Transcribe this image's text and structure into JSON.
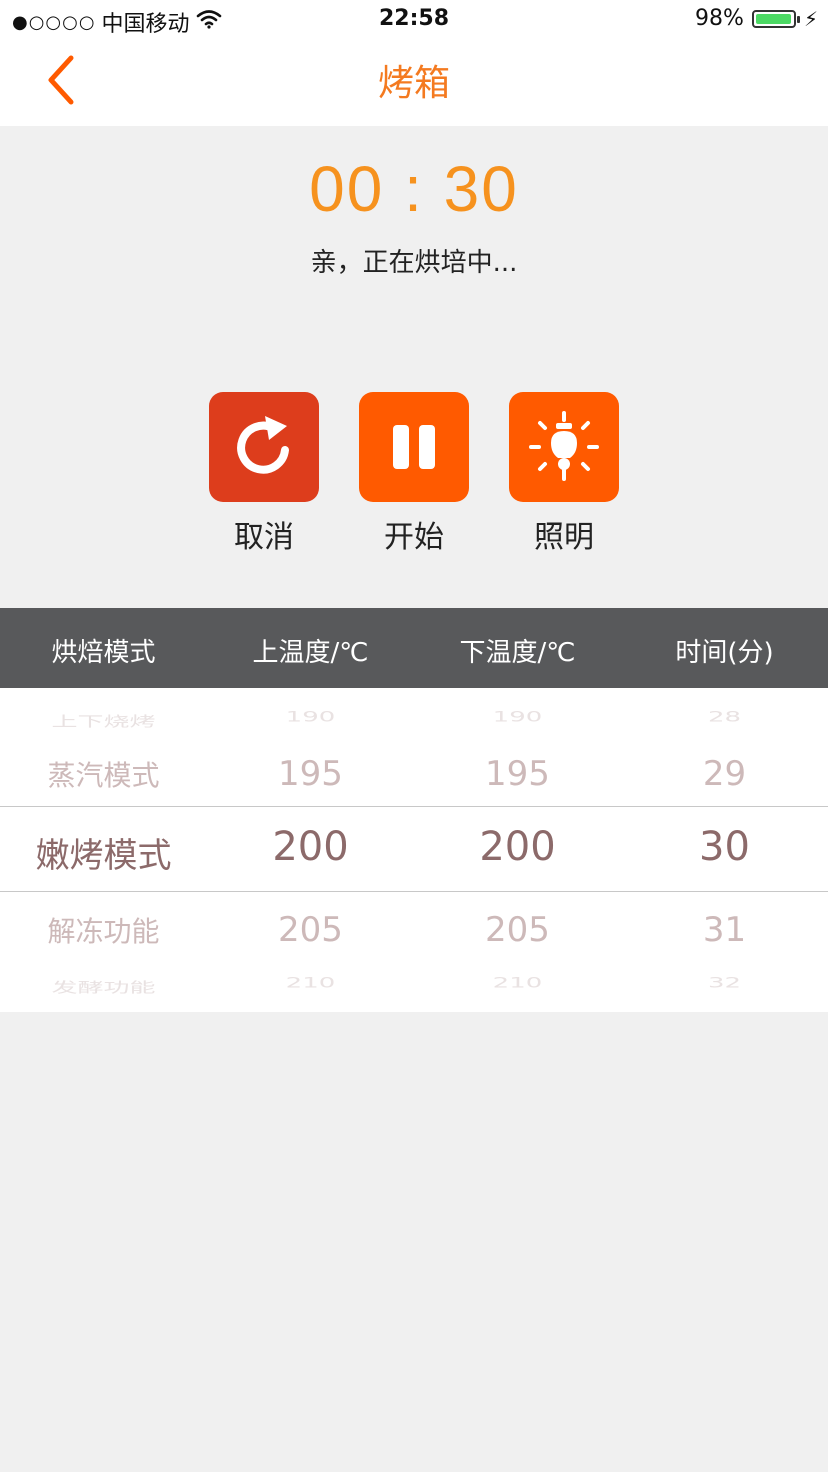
{
  "status_bar": {
    "carrier": "中国移动",
    "signal": "●○○○○",
    "time": "22:58",
    "battery_percent": "98%",
    "battery_level": 0.98
  },
  "nav": {
    "title": "烤箱"
  },
  "timer": {
    "display": "00 : 30",
    "message": "亲，正在烘培中..."
  },
  "actions": [
    {
      "label": "取消",
      "icon": "refresh-icon",
      "color": "#dd3d1c"
    },
    {
      "label": "开始",
      "icon": "pause-icon",
      "color": "#ff5a00"
    },
    {
      "label": "照明",
      "icon": "light-bulb-icon",
      "color": "#ff5a00"
    }
  ],
  "columns": [
    "烘焙模式",
    "上温度/℃",
    "下温度/℃",
    "时间(分)"
  ],
  "picker": {
    "mode": {
      "far_above": "上下烧烤",
      "above": "蒸汽模式",
      "selected": "嫩烤模式",
      "below": "解冻功能",
      "far_below": "发酵功能"
    },
    "top_temp": {
      "far_above": "190",
      "above": "195",
      "selected": "200",
      "below": "205",
      "far_below": "210"
    },
    "bottom_temp": {
      "far_above": "190",
      "above": "195",
      "selected": "200",
      "below": "205",
      "far_below": "210"
    },
    "time": {
      "far_above": "28",
      "above": "29",
      "selected": "30",
      "below": "31",
      "far_below": "32"
    }
  },
  "colors": {
    "accent": "#f47a20",
    "header_bg": "#58595b",
    "background": "#f0f0f0"
  }
}
